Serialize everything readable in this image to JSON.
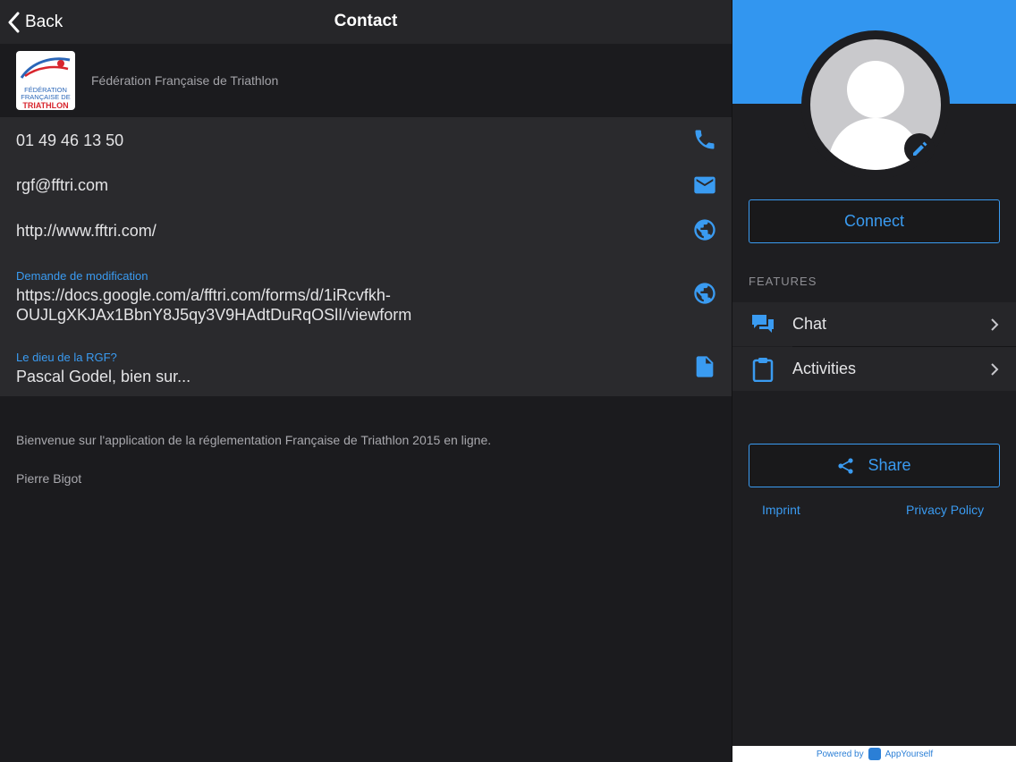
{
  "nav": {
    "back_label": "Back",
    "title": "Contact"
  },
  "organization": {
    "name": "Fédération Française de Triathlon",
    "logo_text": [
      "FÉDÉRATION",
      "FRANÇAISE DE",
      "TRIATHLON"
    ]
  },
  "contact": {
    "phone": "01 49 46 13 50",
    "email": "rgf@fftri.com",
    "website": "http://www.fftri.com/",
    "form": {
      "label": "Demande de modification",
      "line1": "https://docs.google.com/a/fftri.com/forms/d/1iRcvfkh-",
      "line2": "OUJLgXKJAx1BbnY8J5qy3V9HAdtDuRqOSlI/viewform"
    },
    "note": {
      "label": "Le dieu de la RGF?",
      "value": "Pascal Godel, bien sur..."
    }
  },
  "description": "Bienvenue sur l'application de la réglementation Française de Triathlon 2015 en ligne.",
  "signature": "Pierre Bigot",
  "sidebar": {
    "connect_label": "Connect",
    "features_heading": "FEATURES",
    "features": [
      {
        "label": "Chat",
        "icon": "chat-icon"
      },
      {
        "label": "Activities",
        "icon": "clipboard-icon"
      }
    ],
    "share_label": "Share",
    "imprint_label": "Imprint",
    "privacy_label": "Privacy Policy",
    "powered_by": "Powered by",
    "powered_brand": "AppYourself"
  },
  "colors": {
    "accent": "#3a9bf1",
    "header_band": "#3296f0",
    "background": "#1b1b1e",
    "card": "#2a2a2d"
  }
}
